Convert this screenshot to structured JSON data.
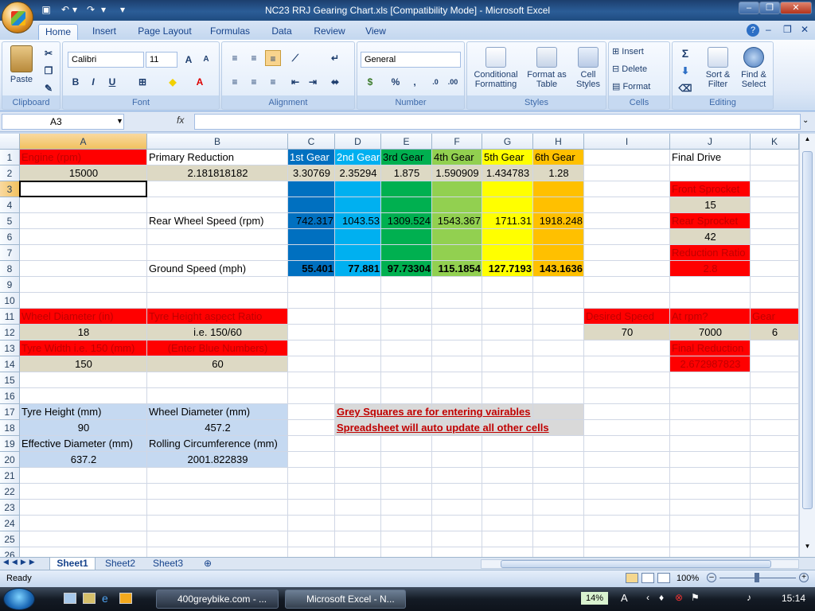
{
  "window": {
    "title": "NC23 RRJ Gearing Chart.xls  [Compatibility Mode] - Microsoft Excel"
  },
  "ribbon_tabs": [
    "Home",
    "Insert",
    "Page Layout",
    "Formulas",
    "Data",
    "Review",
    "View"
  ],
  "ribbon": {
    "clipboard": {
      "label": "Clipboard",
      "paste": "Paste"
    },
    "font": {
      "label": "Font",
      "family": "Calibri",
      "size": "11",
      "bold": "B",
      "italic": "I",
      "underline": "U"
    },
    "alignment": {
      "label": "Alignment"
    },
    "number": {
      "label": "Number",
      "format": "General",
      "percent": "%",
      "comma": ","
    },
    "styles": {
      "label": "Styles",
      "conditional": "Conditional Formatting",
      "format_table": "Format as Table",
      "cell_styles": "Cell Styles"
    },
    "cells": {
      "label": "Cells",
      "insert": "Insert",
      "delete": "Delete",
      "format": "Format"
    },
    "editing": {
      "label": "Editing",
      "sigma": "Σ",
      "sort": "Sort & Filter",
      "find": "Find & Select"
    }
  },
  "formula_bar": {
    "name_box": "A3",
    "fx": "fx",
    "formula": ""
  },
  "columns": [
    "A",
    "B",
    "C",
    "D",
    "E",
    "F",
    "G",
    "H",
    "I",
    "J",
    "K"
  ],
  "rows": [
    "1",
    "2",
    "3",
    "4",
    "5",
    "6",
    "7",
    "8",
    "9",
    "10",
    "11",
    "12",
    "13",
    "14",
    "15",
    "16",
    "17",
    "18",
    "19",
    "20",
    "21",
    "22",
    "23",
    "24",
    "25",
    "26"
  ],
  "cells": {
    "A1": "Engine (rpm)",
    "B1": "Primary Reduction",
    "C1": "1st Gear",
    "D1": "2nd Gear",
    "E1": "3rd Gear",
    "F1": "4th Gear",
    "G1": "5th Gear",
    "H1": "6th Gear",
    "J1": "Final Drive",
    "A2": "15000",
    "B2": "2.181818182",
    "C2": "3.30769",
    "D2": "2.35294",
    "E2": "1.875",
    "F2": "1.590909",
    "G2": "1.434783",
    "H2": "1.28",
    "J3": "Front Sprocket",
    "J4": "15",
    "B5": "Rear Wheel Speed (rpm)",
    "C5": "742.317",
    "D5": "1043.53",
    "E5": "1309.524",
    "F5": "1543.367",
    "G5": "1711.31",
    "H5": "1918.248",
    "J5": "Rear Sprocket",
    "J6": "42",
    "J7": "Reduction Ratio",
    "B8": "Ground Speed (mph)",
    "C8": "55.401",
    "D8": "77.881",
    "E8": "97.73304",
    "F8": "115.1854",
    "G8": "127.7193",
    "H8": "143.1636",
    "J8": "2.8",
    "A11": "Wheel Diameter (in)",
    "B11": "Tyre Height aspect Ratio",
    "I11": "Desired Speed",
    "J11": "At rpm?",
    "K11": "Gear",
    "A12": "18",
    "B12": "i.e. 150/60",
    "I12": "70",
    "J12": "7000",
    "K12": "6",
    "A13": "Tyre Width i.e. 150 (mm)",
    "B13": "(Enter Blue Numbers)",
    "J13": "Final Reduction",
    "A14": "150",
    "B14": "60",
    "J14": "2.672987823",
    "A17": "Tyre Height (mm)",
    "B17": "Wheel Diameter (mm)",
    "D17": "Grey Squares are for entering vairables",
    "A18": "90",
    "B18": "457.2",
    "D18": "Spreadsheet will auto update all other cells",
    "A19": "Effective Diameter (mm)",
    "B19": "Rolling Circumference (mm)",
    "A20": "637.2",
    "B20": "2001.822839"
  },
  "colors": {
    "red": "#ff0000",
    "grey": "#ddd9c4",
    "blue_light": "#c5d9f1",
    "gear1": "#0070c0",
    "gear2": "#00b0f0",
    "gear3": "#00b050",
    "gear4": "#92d050",
    "gear5": "#ffff00",
    "gear6": "#ffc000",
    "note_grey": "#d9d9d9"
  },
  "sheets": [
    "Sheet1",
    "Sheet2",
    "Sheet3"
  ],
  "status": {
    "ready": "Ready",
    "zoom": "100%"
  },
  "taskbar": {
    "items": [
      "400greybike.com - ...",
      "Microsoft Excel - N..."
    ],
    "cpu": "14%",
    "time": "15:14"
  }
}
